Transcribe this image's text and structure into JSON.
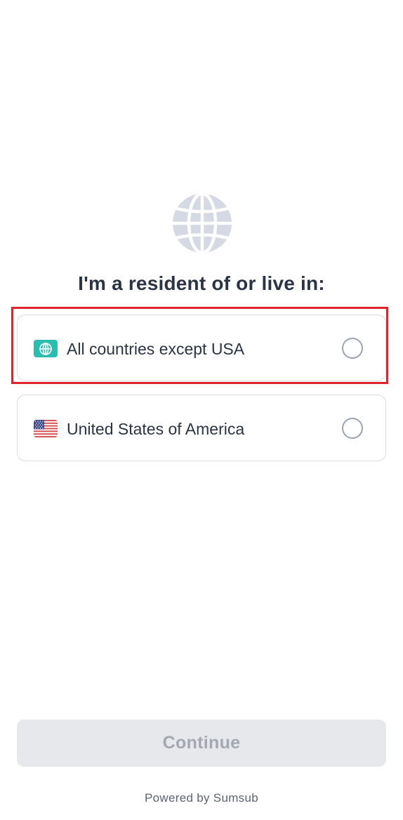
{
  "header": {
    "icon": "globe-icon",
    "title": "I'm a resident of or live in:"
  },
  "options": [
    {
      "label": "All countries except USA",
      "icon": "globe-badge-icon",
      "selected": false,
      "highlighted": true
    },
    {
      "label": "United States of America",
      "icon": "us-flag-icon",
      "selected": false,
      "highlighted": false
    }
  ],
  "footer": {
    "continue_label": "Continue",
    "continue_enabled": false,
    "powered_by": "Powered by Sumsub"
  },
  "colors": {
    "accent": "#2bbdb0",
    "highlight_frame": "#e0242b",
    "disabled_button": "#e6e8ec",
    "globe": "#d5d9e3"
  }
}
